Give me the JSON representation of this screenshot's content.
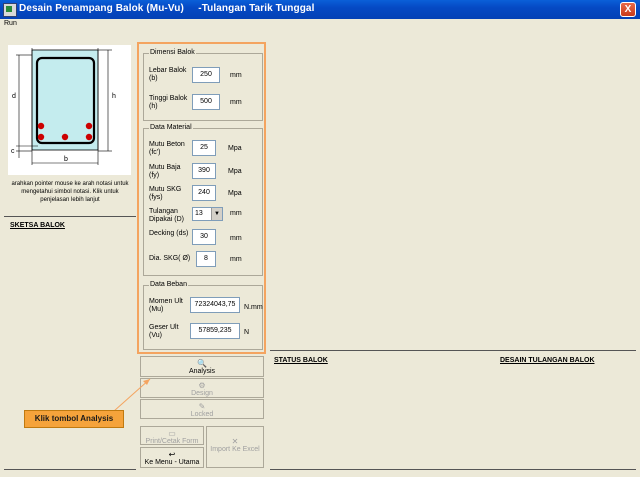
{
  "window": {
    "title": "Desain Penampang Balok (Mu-Vu)     -Tulangan Tarik Tunggal",
    "close_glyph": "X"
  },
  "menu": {
    "items": [
      "Run"
    ]
  },
  "sketch": {
    "dim_labels": {
      "d": "d",
      "h": "h",
      "c": "c",
      "b": "b"
    },
    "hint": "arahkan pointer mouse ke arah notasi untuk mengetahui simbol notasi. Klik untuk penjelasan lebih lanjut",
    "section_label": "SKETSA BALOK"
  },
  "dimensi": {
    "title": "Dimensi Balok",
    "lebar": {
      "label": "Lebar Balok (b)",
      "value": "250",
      "unit": "mm"
    },
    "tinggi": {
      "label": "Tinggi Balok (h)",
      "value": "500",
      "unit": "mm"
    }
  },
  "material": {
    "title": "Data Material",
    "beton": {
      "label": "Mutu Beton (fc')",
      "value": "25",
      "unit": "Mpa"
    },
    "baja": {
      "label": "Mutu Baja (fy)",
      "value": "390",
      "unit": "Mpa"
    },
    "skg": {
      "label": "Mutu SKG (fys)",
      "value": "240",
      "unit": "Mpa"
    },
    "tulangan": {
      "label": "Tulangan Dipakai (D)",
      "value": "13",
      "unit": "mm"
    },
    "decking": {
      "label": "Decking (ds)",
      "value": "30",
      "unit": "mm"
    },
    "dia": {
      "label": "Dia. SKG( Ø)",
      "value": "8",
      "unit": "mm"
    }
  },
  "beban": {
    "title": "Data Beban",
    "momen": {
      "label": "Momen Ult (Mu)",
      "value": "72324043,75",
      "unit": "N.mm"
    },
    "geser": {
      "label": "Geser Ult (Vu)",
      "value": "57859,235",
      "unit": "N"
    }
  },
  "buttons": {
    "analysis": "Analysis",
    "design": "Design",
    "locked": "Locked",
    "print": "Print/Cetak Form",
    "menu_utama": "Ke Menu - Utama",
    "import_excel": "Import Ke Excel"
  },
  "sections": {
    "status": "STATUS BALOK",
    "desain": "DESAIN TULANGAN BALOK"
  },
  "callout": "Klik tombol Analysis",
  "colors": {
    "highlight": "#f4a460",
    "rebar": "#cc0000",
    "callout": "#f5a33b"
  }
}
